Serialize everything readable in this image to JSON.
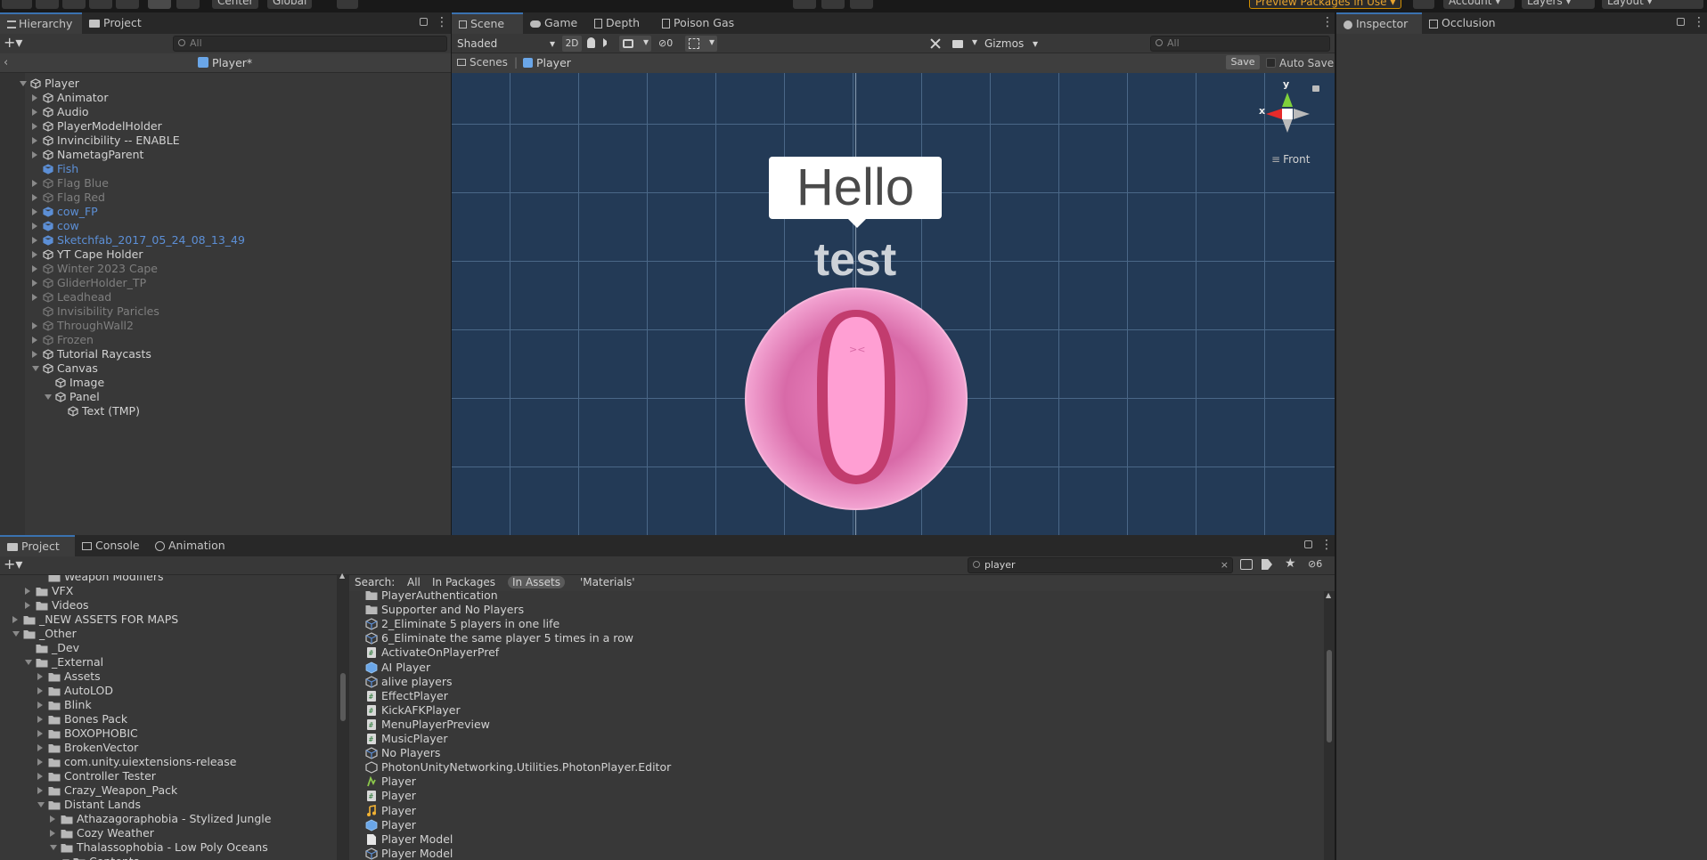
{
  "toolbar": {
    "pivot_label": "Center",
    "space_label": "Global",
    "preview_packages": "Preview Packages in Use",
    "account": "Account",
    "layers": "Layers",
    "layout": "Layout"
  },
  "hierarchy": {
    "tab_hierarchy": "Hierarchy",
    "tab_project": "Project",
    "search_placeholder": "All",
    "prefab_title": "Player*",
    "items": [
      {
        "label": "Player",
        "level": 0,
        "state": "open",
        "style": "white"
      },
      {
        "label": "Animator",
        "level": 1,
        "state": "closed",
        "style": "white"
      },
      {
        "label": "Audio",
        "level": 1,
        "state": "closed",
        "style": "white"
      },
      {
        "label": "PlayerModelHolder",
        "level": 1,
        "state": "closed",
        "style": "white"
      },
      {
        "label": "Invincibility -- ENABLE",
        "level": 1,
        "state": "closed",
        "style": "white"
      },
      {
        "label": "NametagParent",
        "level": 1,
        "state": "closed",
        "style": "white"
      },
      {
        "label": "Fish",
        "level": 1,
        "state": "none",
        "style": "blue"
      },
      {
        "label": "Flag Blue",
        "level": 1,
        "state": "closed",
        "style": "gray"
      },
      {
        "label": "Flag Red",
        "level": 1,
        "state": "closed",
        "style": "gray"
      },
      {
        "label": "cow_FP",
        "level": 1,
        "state": "closed",
        "style": "blue"
      },
      {
        "label": "cow",
        "level": 1,
        "state": "closed",
        "style": "blue"
      },
      {
        "label": "Sketchfab_2017_05_24_08_13_49",
        "level": 1,
        "state": "closed",
        "style": "blue"
      },
      {
        "label": "YT Cape Holder",
        "level": 1,
        "state": "closed",
        "style": "white"
      },
      {
        "label": "Winter 2023 Cape",
        "level": 1,
        "state": "closed",
        "style": "gray"
      },
      {
        "label": "GliderHolder_TP",
        "level": 1,
        "state": "closed",
        "style": "gray"
      },
      {
        "label": "Leadhead",
        "level": 1,
        "state": "closed",
        "style": "gray"
      },
      {
        "label": "Invisibility Paricles",
        "level": 1,
        "state": "none",
        "style": "gray"
      },
      {
        "label": "ThroughWall2",
        "level": 1,
        "state": "closed",
        "style": "gray"
      },
      {
        "label": "Frozen",
        "level": 1,
        "state": "closed",
        "style": "gray"
      },
      {
        "label": "Tutorial Raycasts",
        "level": 1,
        "state": "closed",
        "style": "white"
      },
      {
        "label": "Canvas",
        "level": 1,
        "state": "open",
        "style": "white"
      },
      {
        "label": "Image",
        "level": 2,
        "state": "none",
        "style": "white"
      },
      {
        "label": "Panel",
        "level": 2,
        "state": "open",
        "style": "white"
      },
      {
        "label": "Text (TMP)",
        "level": 3,
        "state": "none",
        "style": "white"
      }
    ]
  },
  "scene": {
    "tabs": [
      "Scene",
      "Game",
      "Depth",
      "Poison Gas"
    ],
    "shading": "Shaded",
    "mode_2d": "2D",
    "hidden_count": "0",
    "gizmos": "Gizmos",
    "search_placeholder": "All",
    "breadcrumb_scenes": "Scenes",
    "breadcrumb_player": "Player",
    "save_label": "Save",
    "auto_save_label": "Auto Save",
    "speech_text": "Hello",
    "nametag_text": "test",
    "gizmo_y": "y",
    "gizmo_x": "x",
    "view_label": "Front"
  },
  "inspector": {
    "tab_inspector": "Inspector",
    "tab_occlusion": "Occlusion"
  },
  "project": {
    "tabs": [
      "Project",
      "Console",
      "Animation"
    ],
    "search_value": "player",
    "hidden_count": "6",
    "search_label": "Search:",
    "filters": [
      "All",
      "In Packages",
      "In Assets",
      "'Materials'"
    ],
    "active_filter": "In Assets",
    "tree": [
      {
        "label": "Weapon Modifiers",
        "level": 2,
        "state": "none",
        "cut": true
      },
      {
        "label": "VFX",
        "level": 1,
        "state": "closed"
      },
      {
        "label": "Videos",
        "level": 1,
        "state": "closed"
      },
      {
        "label": "_NEW ASSETS FOR MAPS",
        "level": 0,
        "state": "closed"
      },
      {
        "label": "_Other",
        "level": 0,
        "state": "open"
      },
      {
        "label": "_Dev",
        "level": 1,
        "state": "none"
      },
      {
        "label": "_External",
        "level": 1,
        "state": "open"
      },
      {
        "label": "Assets",
        "level": 2,
        "state": "closed"
      },
      {
        "label": "AutoLOD",
        "level": 2,
        "state": "closed"
      },
      {
        "label": "Blink",
        "level": 2,
        "state": "closed"
      },
      {
        "label": "Bones Pack",
        "level": 2,
        "state": "closed"
      },
      {
        "label": "BOXOPHOBIC",
        "level": 2,
        "state": "closed"
      },
      {
        "label": "BrokenVector",
        "level": 2,
        "state": "closed"
      },
      {
        "label": "com.unity.uiextensions-release",
        "level": 2,
        "state": "closed"
      },
      {
        "label": "Controller Tester",
        "level": 2,
        "state": "closed"
      },
      {
        "label": "Crazy_Weapon_Pack",
        "level": 2,
        "state": "closed"
      },
      {
        "label": "Distant Lands",
        "level": 2,
        "state": "open"
      },
      {
        "label": "Athazagoraphobia - Stylized Jungle",
        "level": 3,
        "state": "closed"
      },
      {
        "label": "Cozy Weather",
        "level": 3,
        "state": "closed"
      },
      {
        "label": "Thalassophobia - Low Poly Oceans",
        "level": 3,
        "state": "open"
      },
      {
        "label": "Contents",
        "level": 4,
        "state": "open"
      }
    ],
    "results": [
      {
        "label": "PlayerAuthentication",
        "icon": "folder"
      },
      {
        "label": "Supporter and No Players",
        "icon": "folder"
      },
      {
        "label": "2_Eliminate 5 players in one life",
        "icon": "asset"
      },
      {
        "label": "6_Eliminate the same player 5 times in a row",
        "icon": "asset"
      },
      {
        "label": "ActivateOnPlayerPref",
        "icon": "script"
      },
      {
        "label": "AI Player",
        "icon": "prefab"
      },
      {
        "label": "alive players",
        "icon": "asset"
      },
      {
        "label": "EffectPlayer",
        "icon": "script"
      },
      {
        "label": "KickAFKPlayer",
        "icon": "script"
      },
      {
        "label": "MenuPlayerPreview",
        "icon": "script"
      },
      {
        "label": "MusicPlayer",
        "icon": "script"
      },
      {
        "label": "No Players",
        "icon": "asset"
      },
      {
        "label": "PhotonUnityNetworking.Utilities.PhotonPlayer.Editor",
        "icon": "asmdef"
      },
      {
        "label": "Player",
        "icon": "anim"
      },
      {
        "label": "Player",
        "icon": "script"
      },
      {
        "label": "Player",
        "icon": "audio"
      },
      {
        "label": "Player",
        "icon": "prefab"
      },
      {
        "label": "Player Model",
        "icon": "file"
      },
      {
        "label": "Player Model",
        "icon": "asset"
      }
    ]
  },
  "colors": {
    "accent": "#3a72b0",
    "scene_bg": "#233a56",
    "prefab_blue": "#5c8fd6",
    "orange": "#d18e00",
    "pink": "#ff8fc8"
  }
}
